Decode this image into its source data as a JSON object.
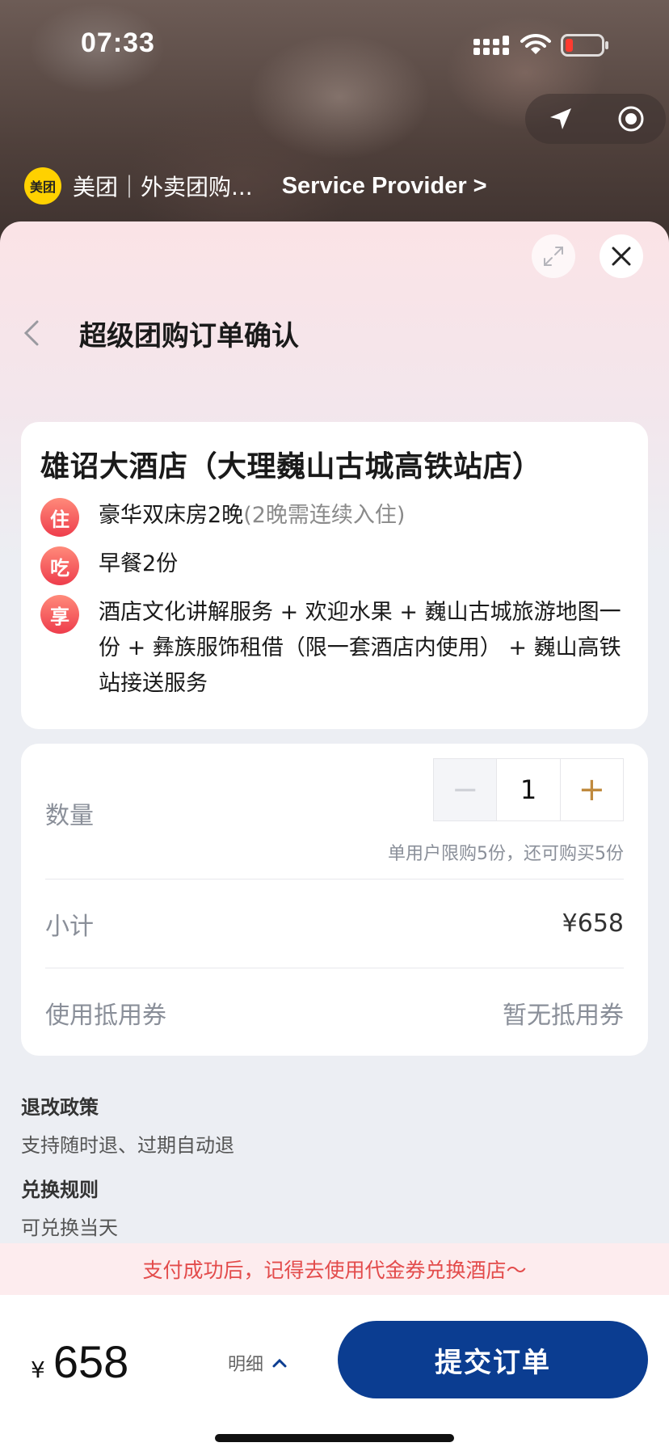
{
  "status_bar": {
    "time": "07:33"
  },
  "provider": {
    "logo_text": "美团",
    "name": "美团｜外卖团购...",
    "link_label": "Service Provider >"
  },
  "page": {
    "title": "超级团购订单确认"
  },
  "hotel": {
    "name": "雄诏大酒店（大理巍山古城高铁站店）",
    "features": [
      {
        "badge": "住",
        "text": "豪华双床房2晚",
        "note": "(2晚需连续入住)"
      },
      {
        "badge": "吃",
        "text": "早餐2份",
        "note": ""
      },
      {
        "badge": "享",
        "text": "酒店文化讲解服务 + 欢迎水果 + 巍山古城旅游地图一份 + 彝族服饰租借（限一套酒店内使用） + 巍山高铁站接送服务",
        "note": ""
      }
    ]
  },
  "order": {
    "quantity_label": "数量",
    "quantity_value": "1",
    "minus_symbol": "−",
    "plus_symbol": "+",
    "limit_note": "单用户限购5份，还可购买5份",
    "subtotal_label": "小计",
    "subtotal_value": "¥658",
    "coupon_label": "使用抵用券",
    "coupon_value": "暂无抵用券"
  },
  "policies": [
    {
      "title": "退改政策",
      "text": "支持随时退、过期自动退"
    },
    {
      "title": "兑换规则",
      "text": "可兑换当天"
    }
  ],
  "tip": "支付成功后，记得去使用代金券兑换酒店～",
  "bottom": {
    "currency": "¥",
    "total": "658",
    "detail_label": "明细",
    "submit_label": "提交订单"
  },
  "colors": {
    "accent_red": "#ee3d4c",
    "submit_blue": "#0b3d91",
    "plus_gold": "#c08a3e",
    "meituan_yellow": "#ffd100"
  }
}
